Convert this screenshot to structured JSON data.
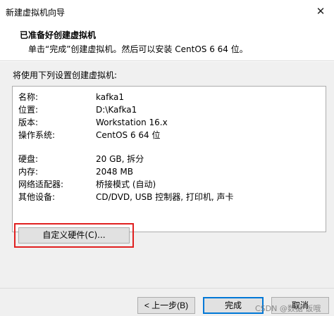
{
  "window": {
    "title": "新建虚拟机向导",
    "close_glyph": "✕"
  },
  "header": {
    "heading": "已准备好创建虚拟机",
    "subtitle": "单击“完成”创建虚拟机。然后可以安装 CentOS 6 64 位。"
  },
  "main": {
    "intro": "将使用下列设置创建虚拟机:",
    "settings": [
      {
        "key": "名称:",
        "value": "kafka1"
      },
      {
        "key": "位置:",
        "value": "D:\\Kafka1"
      },
      {
        "key": "版本:",
        "value": "Workstation 16.x"
      },
      {
        "key": "操作系统:",
        "value": "CentOS 6 64 位"
      },
      {
        "key": "硬盘:",
        "value": "20 GB, 拆分"
      },
      {
        "key": "内存:",
        "value": "2048 MB"
      },
      {
        "key": "网络适配器:",
        "value": "桥接模式 (自动)"
      },
      {
        "key": "其他设备:",
        "value": "CD/DVD, USB 控制器, 打印机, 声卡"
      }
    ],
    "customize_hardware_label": "自定义硬件(C)...",
    "highlight_color": "#e02020"
  },
  "footer": {
    "back_label": "< 上一步(B)",
    "finish_label": "完成",
    "cancel_label": "取消",
    "watermark": "CSDN @数据 饭哦"
  }
}
